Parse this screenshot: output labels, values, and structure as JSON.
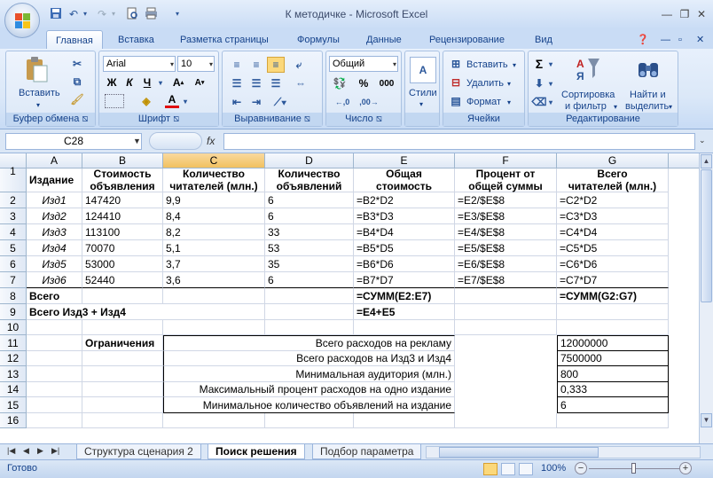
{
  "window": {
    "title": "К методичке",
    "separator": " - ",
    "app": "Microsoft Excel"
  },
  "tabs": [
    "Главная",
    "Вставка",
    "Разметка страницы",
    "Формулы",
    "Данные",
    "Рецензирование",
    "Вид"
  ],
  "ribbon": {
    "clipboard": {
      "label": "Буфер обмена",
      "paste": "Вставить"
    },
    "font": {
      "label": "Шрифт",
      "name": "Arial",
      "size": "10",
      "bold": "Ж",
      "italic": "К",
      "underline": "Ч",
      "font_color_letter": "А"
    },
    "alignment": {
      "label": "Выравнивание"
    },
    "number": {
      "label": "Число",
      "format": "Общий",
      "percent": "%",
      "thousands": "000"
    },
    "styles": {
      "label": "Стили"
    },
    "cells": {
      "label": "Ячейки",
      "insert": "Вставить",
      "delete": "Удалить",
      "format": "Формат"
    },
    "editing": {
      "label": "Редактирование",
      "sum": "Σ",
      "sort_line1": "Сортировка",
      "sort_line2": "и фильтр",
      "find_line1": "Найти и",
      "find_line2": "выделить"
    }
  },
  "formula_bar": {
    "name_box": "C28",
    "fx": "fx",
    "formula": ""
  },
  "columns": [
    "A",
    "B",
    "C",
    "D",
    "E",
    "F",
    "G"
  ],
  "selected_column": "C",
  "rows": [
    "1",
    "2",
    "3",
    "4",
    "5",
    "6",
    "7",
    "8",
    "9",
    "10",
    "11",
    "12",
    "13",
    "14",
    "15",
    "16"
  ],
  "headers": {
    "A": "Издание",
    "B1": "Стоимость",
    "B2": "объявления",
    "C1": "Количество",
    "C2": "читателей (млн.)",
    "D1": "Количество",
    "D2": "объявлений",
    "E1": "Общая",
    "E2": "стоимость",
    "F1": "Процент от",
    "F2": "общей суммы",
    "G1": "Всего",
    "G2": "читателей (млн.)"
  },
  "table": [
    [
      "Изд1",
      "147420",
      "9,9",
      "6",
      "=B2*D2",
      "=E2/$E$8",
      "=C2*D2"
    ],
    [
      "Изд2",
      "124410",
      "8,4",
      "6",
      "=B3*D3",
      "=E3/$E$8",
      "=C3*D3"
    ],
    [
      "Изд3",
      "113100",
      "8,2",
      "33",
      "=B4*D4",
      "=E4/$E$8",
      "=C4*D4"
    ],
    [
      "Изд4",
      "70070",
      "5,1",
      "53",
      "=B5*D5",
      "=E5/$E$8",
      "=C5*D5"
    ],
    [
      "Изд5",
      "53000",
      "3,7",
      "35",
      "=B6*D6",
      "=E6/$E$8",
      "=C6*D6"
    ],
    [
      "Изд6",
      "52440",
      "3,6",
      "6",
      "=B7*D7",
      "=E7/$E$8",
      "=C7*D7"
    ]
  ],
  "row8": {
    "label": "Всего",
    "E": "=СУММ(E2:E7)",
    "G": "=СУММ(G2:G7)"
  },
  "row9": {
    "label": "Всего Изд3 + Изд4",
    "E": "=E4+E5"
  },
  "constraints": {
    "label": "Ограничения",
    "items": [
      {
        "text": "Всего расходов на рекламу",
        "value": "12000000"
      },
      {
        "text": "Всего расходов на Изд3 и Изд4",
        "value": "7500000"
      },
      {
        "text": "Минимальная аудитория (млн.)",
        "value": "800"
      },
      {
        "text": "Максимальный процент расходов на одно издание",
        "value": "0,333"
      },
      {
        "text": "Минимальное количество объявлений на издание",
        "value": "6"
      }
    ]
  },
  "sheets": [
    "Структура сценария 2",
    "Поиск решения",
    "Подбор параметра"
  ],
  "active_sheet": "Поиск решения",
  "status": {
    "ready": "Готово",
    "zoom": "100%",
    "minus": "−",
    "plus": "+"
  },
  "colors": {
    "accent": "#15428b",
    "selected_header": "#f1c15f",
    "ribbon_bg": "#dbe8f8"
  }
}
